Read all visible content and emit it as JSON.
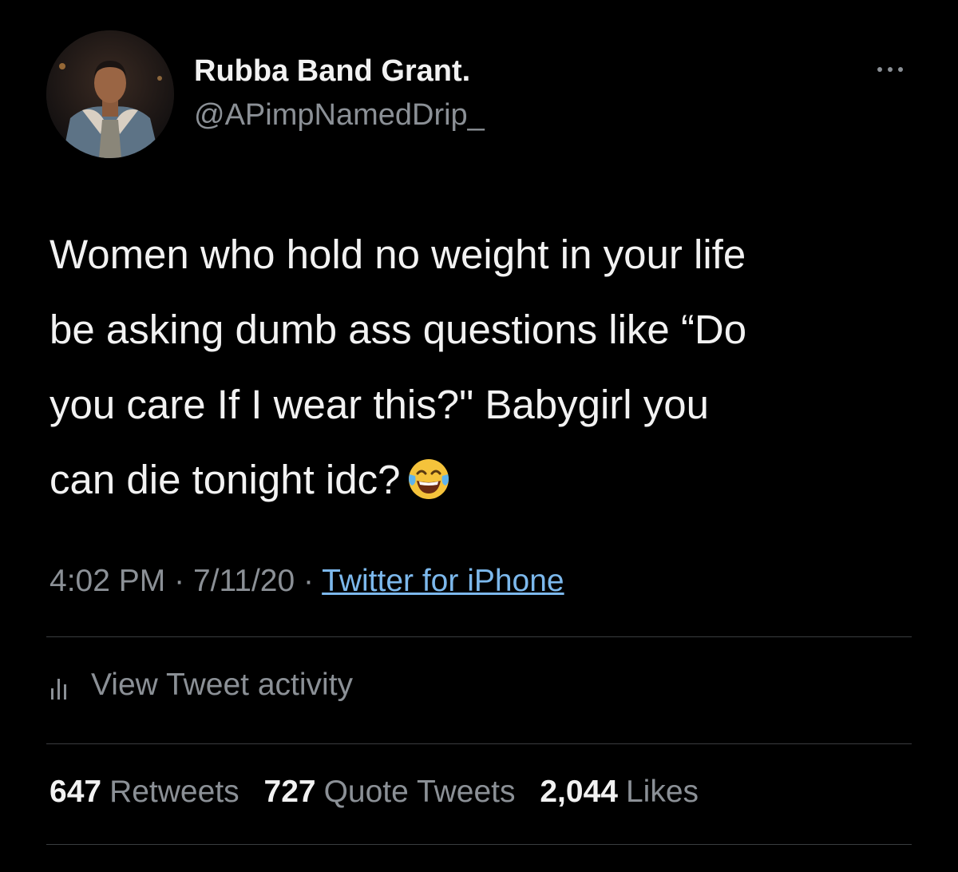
{
  "author": {
    "name": "Rubba Band Grant.",
    "handle": "@APimpNamedDrip_"
  },
  "tweet": {
    "text": "Women who hold no weight in your life\nbe asking dumb ass questions like “Do\nyou care If I wear this?\" Babygirl you\ncan die tonight idc?",
    "emoji": "face-with-tears-of-joy"
  },
  "meta": {
    "time": "4:02 PM",
    "separator": "·",
    "date": "7/11/20",
    "source": "Twitter for iPhone"
  },
  "activity": {
    "label": "View Tweet activity",
    "icon": "bar-chart-icon"
  },
  "stats": {
    "retweets": {
      "count": "647",
      "label": "Retweets"
    },
    "quote_tweets": {
      "count": "727",
      "label": "Quote Tweets"
    },
    "likes": {
      "count": "2,044",
      "label": "Likes"
    }
  },
  "colors": {
    "background": "#000000",
    "text": "#f2f2f2",
    "secondary": "#8b9096",
    "link": "#7cb8ec",
    "divider": "#3a3d40"
  }
}
